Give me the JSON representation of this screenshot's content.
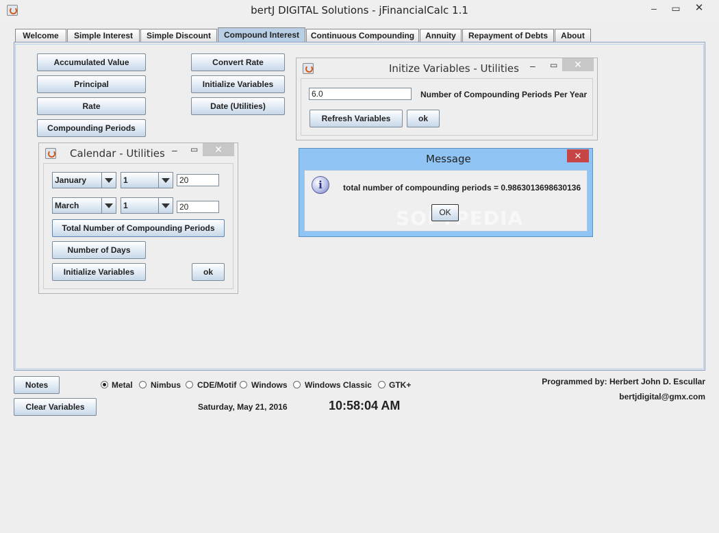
{
  "window": {
    "title": "bertJ DIGITAL Solutions - jFinancialCalc 1.1",
    "minimize": "▭",
    "close": "✕"
  },
  "tabs": [
    {
      "label": "Welcome"
    },
    {
      "label": "Simple Interest"
    },
    {
      "label": "Simple Discount"
    },
    {
      "label": "Compound Interest",
      "active": true
    },
    {
      "label": "Continuous Compounding"
    },
    {
      "label": "Annuity"
    },
    {
      "label": "Repayment of Debts"
    },
    {
      "label": "About"
    }
  ],
  "compound": {
    "accumulated_value": "Accumulated Value",
    "principal": "Principal",
    "rate": "Rate",
    "compounding_periods": "Compounding Periods",
    "convert_rate": "Convert Rate",
    "initialize_variables": "Initialize Variables",
    "date_utilities": "Date (Utilities)"
  },
  "init_frame": {
    "title": "Initize Variables - Utilities",
    "periods_value": "6.0",
    "periods_label": "Number of Compounding Periods Per Year",
    "refresh_button": "Refresh Variables",
    "ok_button": "ok"
  },
  "calendar_frame": {
    "title": "Calendar - Utilities",
    "from_month": "January",
    "from_day": "1",
    "from_year": "20",
    "to_month": "March",
    "to_day": "1",
    "to_year": "20",
    "total_periods_button": "Total Number of Compounding Periods",
    "number_of_days_button": "Number of Days",
    "initialize_button": "Initialize Variables",
    "ok_button": "ok"
  },
  "message": {
    "title": "Message",
    "text": "total number of compounding periods = 0.9863013698630136",
    "ok_button": "OK",
    "watermark": "SOFTPEDIA"
  },
  "bottom": {
    "notes_button": "Notes",
    "clear_button": "Clear Variables",
    "look_and_feel": [
      {
        "label": "Metal",
        "selected": true
      },
      {
        "label": "Nimbus",
        "selected": false
      },
      {
        "label": "CDE/Motif",
        "selected": false
      },
      {
        "label": "Windows",
        "selected": false
      },
      {
        "label": "Windows Classic",
        "selected": false
      },
      {
        "label": "GTK+",
        "selected": false
      }
    ],
    "date": "Saturday, May 21, 2016",
    "time": "10:58:04 AM",
    "programmed_by": "Programmed by: Herbert John D. Escullar",
    "email": "bertjdigital@gmx.com"
  }
}
